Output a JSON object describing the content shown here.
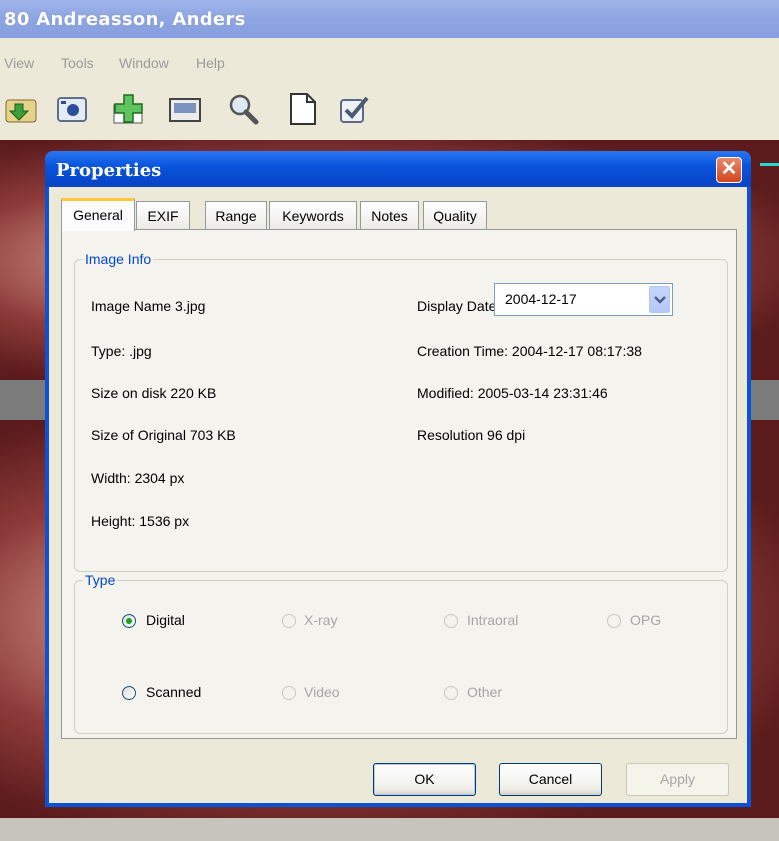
{
  "app": {
    "title": "80 Andreasson, Anders",
    "menu": [
      "View",
      "Tools",
      "Window",
      "Help"
    ]
  },
  "toolbar_icons": [
    "folder-import-icon",
    "camera-icon",
    "add-icon",
    "image-icon",
    "magnifier-icon",
    "document-icon",
    "checkbox-icon"
  ],
  "dialog": {
    "title": "Properties",
    "close_label": "✕",
    "tabs": [
      "General",
      "EXIF",
      "Range",
      "Keywords",
      "Notes",
      "Quality"
    ],
    "active_tab": "General",
    "image_info": {
      "legend": "Image Info",
      "image_name": "Image Name 3.jpg",
      "type": "Type: .jpg",
      "size_on_disk": "Size on disk 220 KB",
      "size_original": "Size of Original 703 KB",
      "width": "Width: 2304 px",
      "height": "Height: 1536 px",
      "display_date_label": "Display Date:",
      "display_date_value": "2004-12-17",
      "creation_time": "Creation Time: 2004-12-17 08:17:38",
      "modified": "Modified: 2005-03-14 23:31:46",
      "resolution": "Resolution 96 dpi"
    },
    "type_group": {
      "legend": "Type",
      "options": [
        {
          "label": "Digital",
          "checked": true,
          "enabled": true
        },
        {
          "label": "X-ray",
          "checked": false,
          "enabled": false
        },
        {
          "label": "Intraoral",
          "checked": false,
          "enabled": false
        },
        {
          "label": "OPG",
          "checked": false,
          "enabled": false
        },
        {
          "label": "Scanned",
          "checked": false,
          "enabled": true
        },
        {
          "label": "Video",
          "checked": false,
          "enabled": false
        },
        {
          "label": "Other",
          "checked": false,
          "enabled": false
        }
      ]
    },
    "buttons": {
      "ok": "OK",
      "cancel": "Cancel",
      "apply": "Apply"
    }
  }
}
